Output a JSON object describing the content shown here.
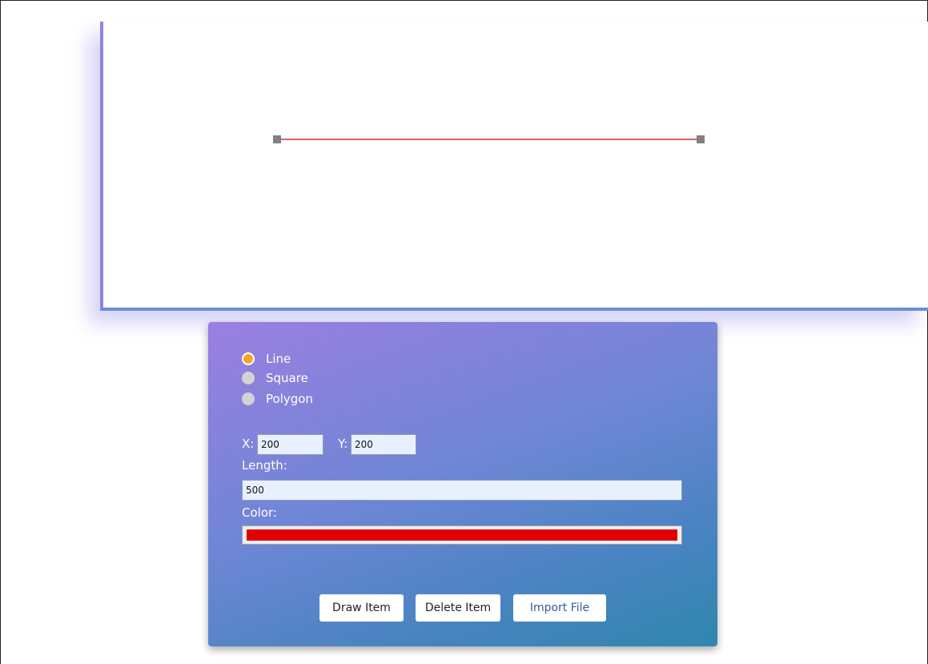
{
  "shape_options": [
    {
      "label": "Line",
      "checked": true
    },
    {
      "label": "Square",
      "checked": false
    },
    {
      "label": "Polygon",
      "checked": false
    }
  ],
  "fields": {
    "x_label": "X:",
    "x_value": "200",
    "y_label": "Y:",
    "y_value": "200",
    "length_label": "Length:",
    "length_value": "500",
    "color_label": "Color:",
    "color_value": "#e00000"
  },
  "buttons": {
    "draw": "Draw Item",
    "delete": "Delete Item",
    "import": "Import File"
  },
  "drawing": {
    "line_color": "#e06060",
    "handle_color": "#808080"
  }
}
